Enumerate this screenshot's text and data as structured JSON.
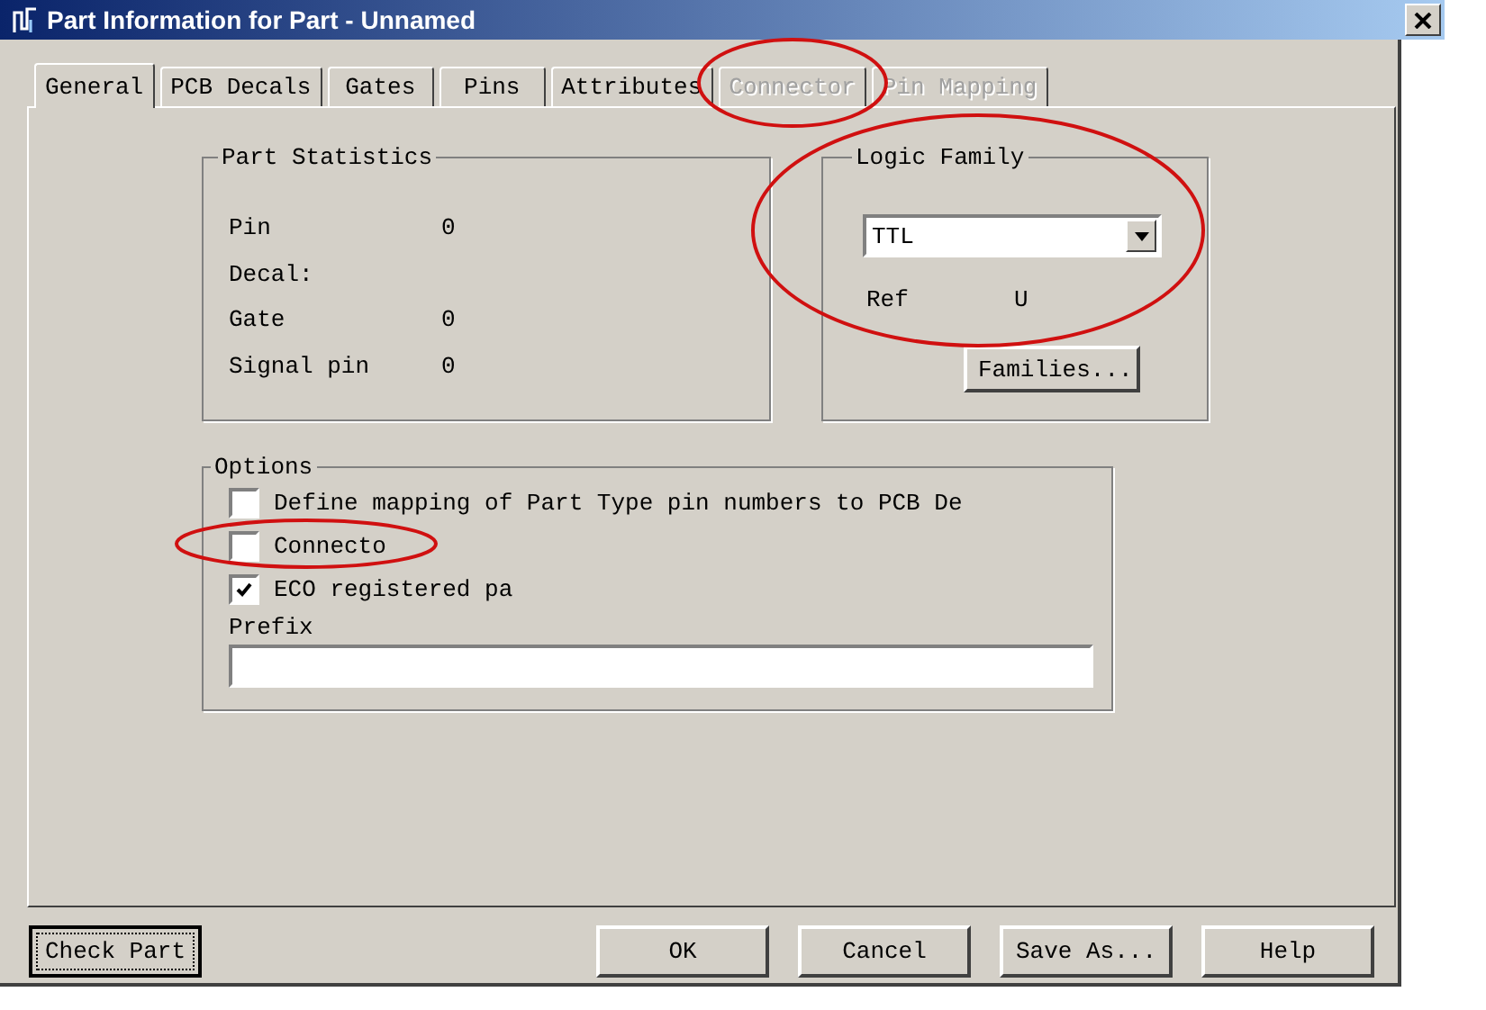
{
  "window": {
    "title": "Part Information for Part - Unnamed"
  },
  "tabs": [
    {
      "label": "General",
      "selected": true,
      "disabled": false
    },
    {
      "label": "PCB Decals",
      "selected": false,
      "disabled": false
    },
    {
      "label": "Gates",
      "selected": false,
      "disabled": false
    },
    {
      "label": "Pins",
      "selected": false,
      "disabled": false
    },
    {
      "label": "Attributes",
      "selected": false,
      "disabled": false
    },
    {
      "label": "Connector",
      "selected": false,
      "disabled": true
    },
    {
      "label": "Pin Mapping",
      "selected": false,
      "disabled": true
    }
  ],
  "part_statistics": {
    "title": "Part Statistics",
    "rows": [
      {
        "label": "Pin",
        "value": "0"
      },
      {
        "label": "Decal:"
      },
      {
        "label": "Gate",
        "value": "0"
      },
      {
        "label": "Signal pin",
        "value": "0"
      }
    ]
  },
  "logic_family": {
    "title": "Logic Family",
    "dropdown": "TTL",
    "ref_label": "Ref",
    "ref_value": "U",
    "button": "Families..."
  },
  "options": {
    "title": "Options",
    "checkboxes": [
      {
        "label": "Define mapping of Part Type pin numbers to PCB De",
        "checked": false
      },
      {
        "label": "Connecto",
        "checked": false
      },
      {
        "label": "ECO registered pa",
        "checked": true
      }
    ],
    "prefix_label": "Prefix"
  },
  "buttons": [
    {
      "label": "Check Part",
      "focused": true
    },
    {
      "label": "OK",
      "focused": false
    },
    {
      "label": "Cancel",
      "focused": false
    },
    {
      "label": "Save As...",
      "focused": false
    },
    {
      "label": "Help",
      "focused": false
    }
  ]
}
